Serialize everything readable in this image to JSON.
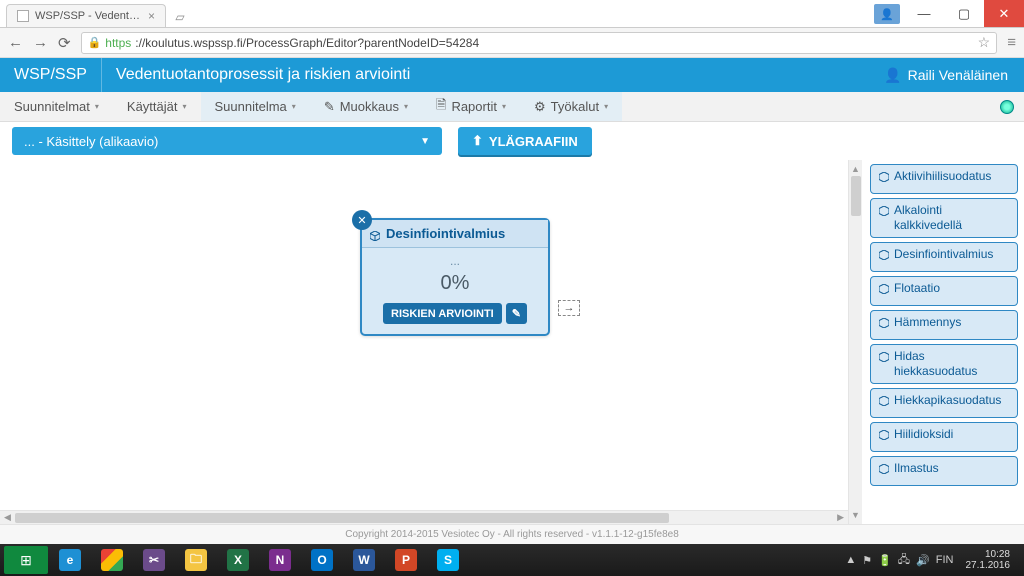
{
  "browser": {
    "tab_title": "WSP/SSP - Vedentuotanto",
    "url_https": "https",
    "url_rest": "://koulutus.wspssp.fi/ProcessGraph/Editor?parentNodeID=54284"
  },
  "app": {
    "logo": "WSP/SSP",
    "title": "Vedentuotantoprosessit ja riskien arviointi",
    "user": "Raili Venäläinen"
  },
  "menu": {
    "suunnitelmat": "Suunnitelmat",
    "kayttajat": "Käyttäjät",
    "suunnitelma": "Suunnitelma",
    "muokkaus": "Muokkaus",
    "raportit": "Raportit",
    "tyokalut": "Työkalut"
  },
  "toolbar": {
    "breadcrumb": "... - Käsittely (alikaavio)",
    "up_button": "YLÄGRAAFIIN"
  },
  "node": {
    "title": "Desinfiointivalmius",
    "subtitle": "...",
    "percent": "0%",
    "risk_btn": "RISKIEN ARVIOINTI"
  },
  "palette": [
    "Aktiivihiilisuodatus",
    "Alkalointi kalkkivedellä",
    "Desinfiointivalmius",
    "Flotaatio",
    "Hämmennys",
    "Hidas hiekkasuodatus",
    "Hiekkapikasuodatus",
    "Hiilidioksidi",
    "Ilmastus"
  ],
  "footer": "Copyright 2014-2015 Vesiotec Oy - All rights reserved - v1.1.1-12-g15fe8e8",
  "tray": {
    "lang": "FIN",
    "time": "10:28",
    "date": "27.1.2016"
  }
}
